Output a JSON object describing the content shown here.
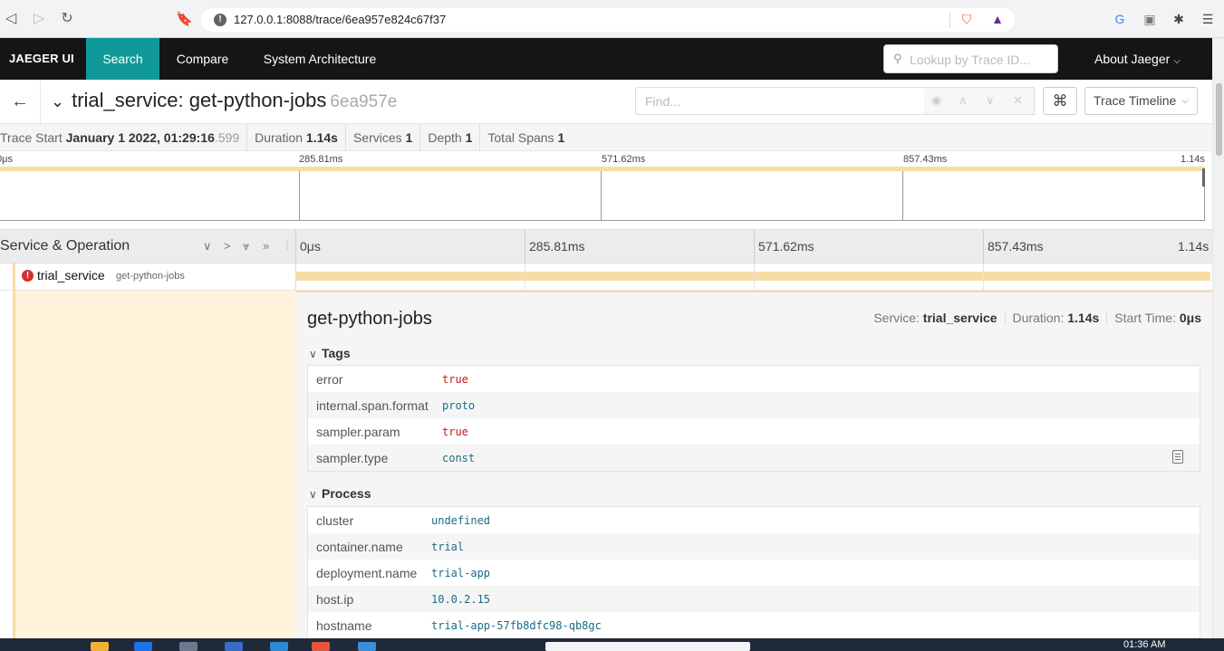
{
  "browser": {
    "url": "127.0.0.1:8088/trace/6ea957e824c67f37"
  },
  "nav": {
    "brand": "JAEGER UI",
    "items": [
      "Search",
      "Compare",
      "System Architecture"
    ],
    "lookup_placeholder": "Lookup by Trace ID...",
    "about": "About Jaeger"
  },
  "trace": {
    "service": "trial_service",
    "separator": ": ",
    "operation": "get-python-jobs",
    "short_id": "6ea957e",
    "find_placeholder": "Find...",
    "view_mode": "Trace Timeline"
  },
  "summary": {
    "start_label": "Trace Start",
    "start_value": "January 1 2022, 01:29:16",
    "start_ms": ".599",
    "duration_label": "Duration",
    "duration_value": "1.14s",
    "services_label": "Services",
    "services_value": "1",
    "depth_label": "Depth",
    "depth_value": "1",
    "spans_label": "Total Spans",
    "spans_value": "1"
  },
  "minimap_ticks": [
    "0μs",
    "285.81ms",
    "571.62ms",
    "857.43ms",
    "1.14s"
  ],
  "timeline": {
    "header_label": "Service & Operation",
    "ticks": [
      "0μs",
      "285.81ms",
      "571.62ms",
      "857.43ms",
      "1.14s"
    ]
  },
  "span": {
    "service": "trial_service",
    "operation": "get-python-jobs",
    "has_error": true
  },
  "detail": {
    "operation": "get-python-jobs",
    "service_label": "Service:",
    "service_value": "trial_service",
    "duration_label": "Duration:",
    "duration_value": "1.14s",
    "start_label": "Start Time:",
    "start_value": "0μs",
    "tags_title": "Tags",
    "tags": [
      {
        "key": "error",
        "value": "true"
      },
      {
        "key": "internal.span.format",
        "value": "proto"
      },
      {
        "key": "sampler.param",
        "value": "true"
      },
      {
        "key": "sampler.type",
        "value": "const"
      }
    ],
    "process_title": "Process",
    "process": [
      {
        "key": "cluster",
        "value": "undefined"
      },
      {
        "key": "container.name",
        "value": "trial"
      },
      {
        "key": "deployment.name",
        "value": "trial-app"
      },
      {
        "key": "host.ip",
        "value": "10.0.2.15"
      },
      {
        "key": "hostname",
        "value": "trial-app-57fb8dfc98-qb8gc"
      }
    ]
  },
  "taskbar": {
    "clock": "01:36 AM"
  },
  "colors": {
    "nav_bg": "#151515",
    "nav_active": "#119999",
    "span_bar": "#f7dca6",
    "error": "#d32f2f"
  }
}
